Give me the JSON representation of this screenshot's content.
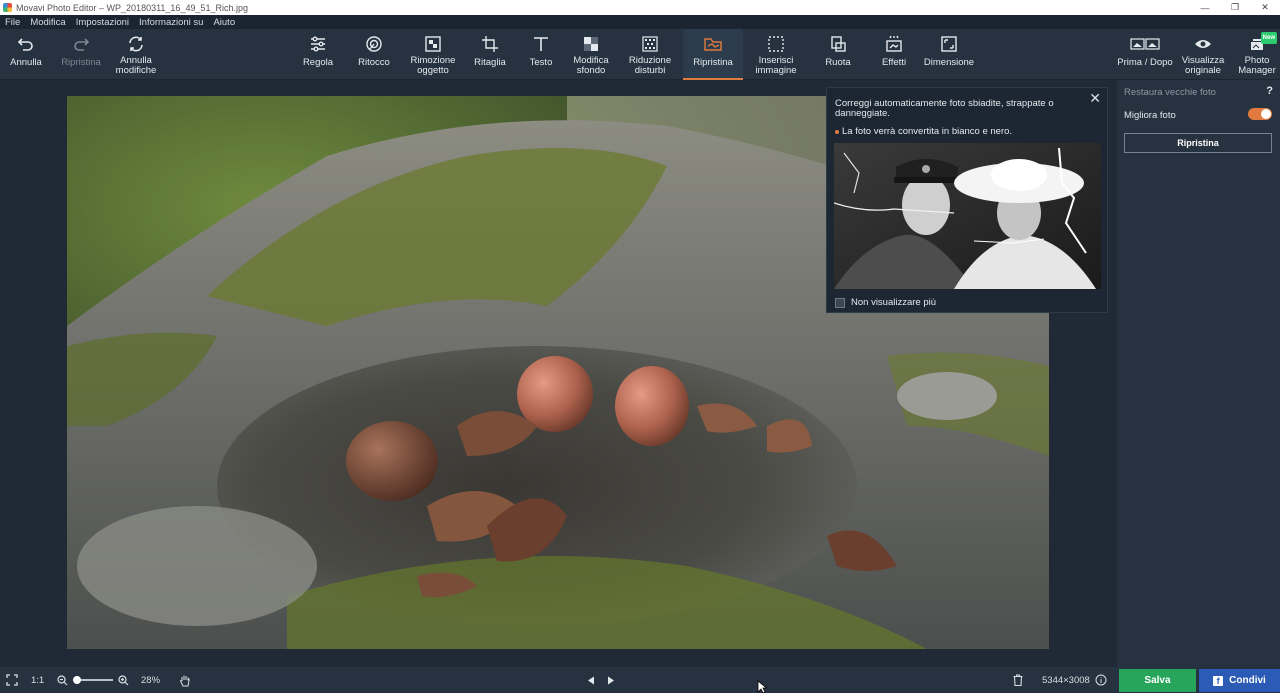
{
  "window": {
    "title": "Movavi Photo Editor – WP_20180311_16_49_51_Rich.jpg"
  },
  "menu": [
    "File",
    "Modifica",
    "Impostazioni",
    "Informazioni su",
    "Aiuto"
  ],
  "toolbar": {
    "undo": "Annulla",
    "redo": "Ripristina",
    "undo_all": [
      "Annulla",
      "modifiche"
    ],
    "adjust": "Regola",
    "retouch": "Ritocco",
    "object_removal": [
      "Rimozione",
      "oggetto"
    ],
    "crop": "Ritaglia",
    "text": "Testo",
    "change_bg": [
      "Modifica",
      "sfondo"
    ],
    "denoise": [
      "Riduzione",
      "disturbi"
    ],
    "restore": "Ripristina",
    "insert_image": [
      "Inserisci",
      "immagine"
    ],
    "rotate": "Ruota",
    "effects": "Effetti",
    "resize": "Dimensione",
    "before_after": "Prima / Dopo",
    "show_original": [
      "Visualizza",
      "originale"
    ],
    "photo_manager": [
      "Photo",
      "Manager"
    ],
    "new_badge": "New"
  },
  "popup": {
    "description": "Correggi automaticamente foto sbiadite, strappate o danneggiate.",
    "note": "La foto verrà convertita in bianco e nero.",
    "dont_show": "Non visualizzare più"
  },
  "panel": {
    "title": "Restaura vecchie foto",
    "help": "?",
    "enhance_label": "Migliora foto",
    "enhance_on": true,
    "button": "Ripristina"
  },
  "status": {
    "one_to_one": "1:1",
    "zoom": "28%",
    "zoom_level": 0.1,
    "dimensions": "5344×3008",
    "save": "Salva",
    "share": "Condivi"
  },
  "colors": {
    "accent": "#e07a3f",
    "save": "#27a55a",
    "share": "#2c5bb5"
  }
}
